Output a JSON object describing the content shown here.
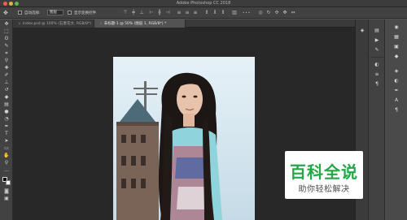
{
  "window": {
    "title": "Adobe Photoshop CC 2018"
  },
  "options_bar": {
    "auto_select_label": "自动选择:",
    "auto_select_value": "图层",
    "show_transform_label": "显示变换控件"
  },
  "tabs": [
    {
      "label": "index.psd @ 100% (石墨花文, RGB/8*)",
      "active": false
    },
    {
      "label": "未标题-1 @ 50% (图层 1, RGB/8*) *",
      "active": true
    }
  ],
  "tools": [
    "move-tool",
    "marquee-tool",
    "lasso-tool",
    "quick-select-tool",
    "crop-tool",
    "eyedropper-tool",
    "healing-brush-tool",
    "brush-tool",
    "clone-stamp-tool",
    "history-brush-tool",
    "eraser-tool",
    "gradient-tool",
    "blur-tool",
    "dodge-tool",
    "pen-tool",
    "type-tool",
    "path-select-tool",
    "rectangle-tool",
    "hand-tool",
    "zoom-tool",
    "more-tools",
    "color-swatches"
  ],
  "watermark": {
    "title": "百科全说",
    "subtitle": "助你轻松解决",
    "title_color": "#23a847",
    "subtitle_color": "#4b4b4b"
  },
  "colors": {
    "window_bg": "#535353",
    "canvas_bg": "#282828",
    "toolbar_bg": "#424242",
    "close": "#ec5f57",
    "minimize": "#e0b53c",
    "maximize": "#5fb847"
  }
}
